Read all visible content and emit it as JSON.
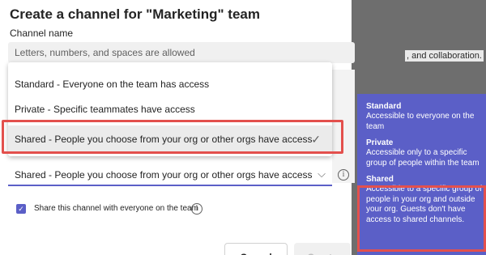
{
  "dialog": {
    "title": "Create a channel for \"Marketing\" team",
    "channel_name_label": "Channel name",
    "channel_name_placeholder": "Letters, numbers, and spaces are allowed",
    "description_fragment": ", and collaboration."
  },
  "privacy_menu": {
    "items": [
      {
        "label": "Standard - Everyone on the team has access"
      },
      {
        "label": "Private - Specific teammates have access"
      },
      {
        "label": "Shared - People you choose from your org or other orgs have access",
        "selected": true
      }
    ],
    "selected_value": "Shared - People you choose from your org or other orgs have access",
    "check_glyph": "✓",
    "chevron_glyph": "⌵"
  },
  "share_option": {
    "checked": true,
    "label": "Share this channel with everyone on the team"
  },
  "tooltip": {
    "items": [
      {
        "title": "Standard",
        "body": "Accessible to everyone on the team"
      },
      {
        "title": "Private",
        "body": "Accessible only to a specific group of people within the team"
      },
      {
        "title": "Shared",
        "body": "Accessible to a specific group of people in your org and outside your org. Guests don't have access to shared channels."
      }
    ]
  },
  "buttons": {
    "cancel": "Cancel",
    "create": "Create"
  },
  "colors": {
    "accent": "#5b5fc7",
    "highlight": "#e3504d"
  }
}
